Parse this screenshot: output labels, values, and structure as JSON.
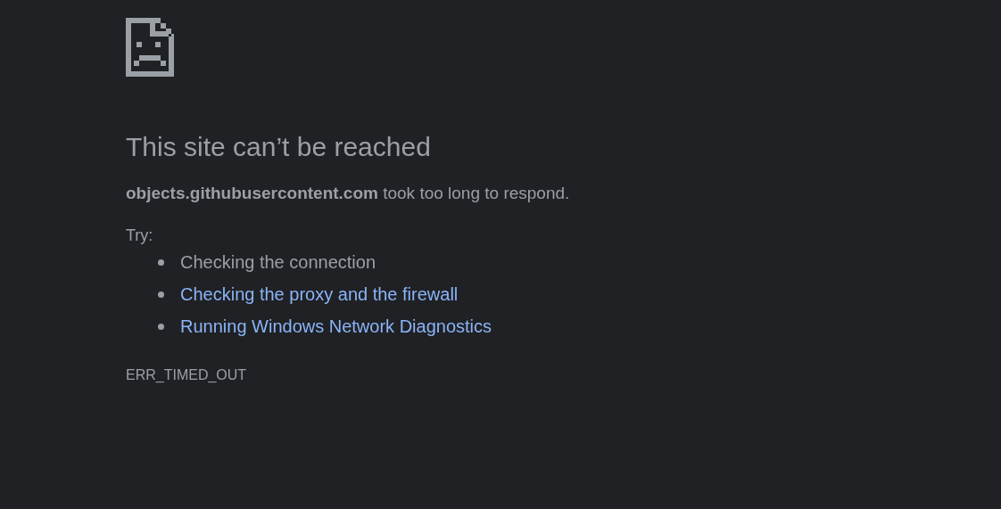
{
  "title": "This site can’t be reached",
  "message": "**objects.githubusercontent.com** took too long to respond.",
  "try_label": "Try:",
  "suggestions": [
    {
      "text": "Checking the connection",
      "kind": "text"
    },
    {
      "text": "Checking the proxy and the firewall",
      "kind": "link"
    },
    {
      "text": "Running Windows Network Diagnostics",
      "kind": "link"
    }
  ],
  "error_code": "ERR_TIMED_OUT"
}
